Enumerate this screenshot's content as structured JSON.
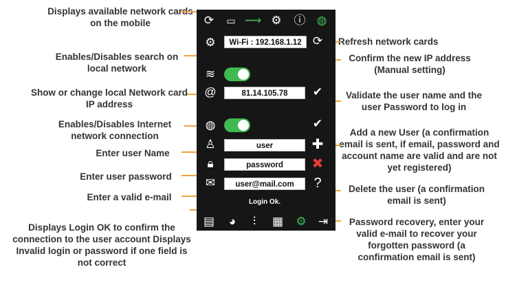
{
  "annotations_left": {
    "cards": "Displays available network cards on the mobile",
    "search": "Enables/Disables search on local network",
    "ip": "Show or change local Network card IP address",
    "internet": "Enables/Disables Internet network connection",
    "user": "Enter user Name",
    "password": "Enter user password",
    "email": "Enter a valid e-mail",
    "login": "Displays Login OK to confirm the connection to the user account Displays Invalid login or password if one field is not correct"
  },
  "annotations_right": {
    "refresh": "Refresh network cards",
    "confirm_ip": "Confirm the new IP address (Manual setting)",
    "validate": "Validate the user name and the user Password to log in",
    "add_user": "Add a new User (a confirmation email is sent, if email, password and account name are valid and are not yet registered)",
    "delete_user": "Delete the user (a confirmation email is sent)",
    "recovery": "Password recovery, enter your valid e-mail to recover your forgotten password (a confirmation email is sent)"
  },
  "phone": {
    "wifi_select": "Wi-Fi : 192.168.1.12",
    "ip_value": "81.14.105.78",
    "user_value": "user",
    "password_value": "password",
    "email_value": "user@mail.com",
    "status": "Login Ok."
  },
  "icons": {
    "top": [
      "refresh-icon",
      "screen-icon",
      "satellite-icon",
      "gear-icon",
      "info-icon",
      "globe-icon"
    ],
    "bottom": [
      "film-icon",
      "palette-icon",
      "sliders-icon",
      "calendar-gear-icon",
      "gear-icon",
      "exit-icon"
    ]
  },
  "colors": {
    "accent": "#f0a040",
    "green": "#3fb950",
    "red": "#e53935",
    "panel": "#161616"
  }
}
